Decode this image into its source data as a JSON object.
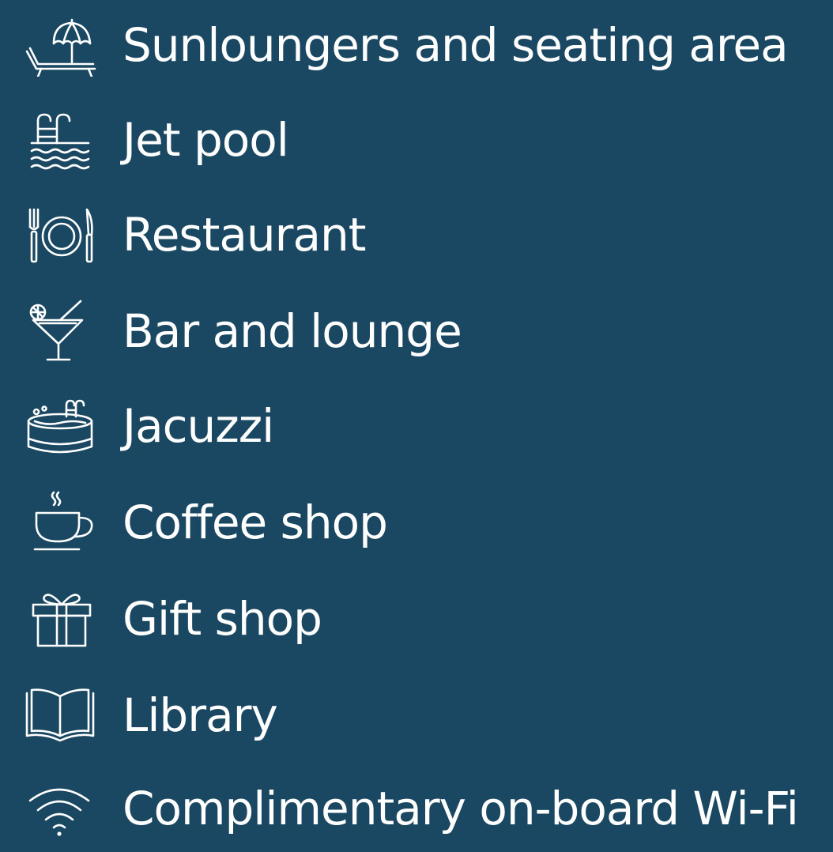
{
  "amenities": [
    {
      "icon": "sunlounger-umbrella-icon",
      "label": "Sunloungers and seating area"
    },
    {
      "icon": "pool-ladder-icon",
      "label": "Jet pool"
    },
    {
      "icon": "plate-cutlery-icon",
      "label": "Restaurant"
    },
    {
      "icon": "cocktail-glass-icon",
      "label": "Bar and lounge"
    },
    {
      "icon": "hot-tub-icon",
      "label": "Jacuzzi"
    },
    {
      "icon": "coffee-cup-icon",
      "label": "Coffee shop"
    },
    {
      "icon": "gift-box-icon",
      "label": "Gift shop"
    },
    {
      "icon": "open-book-icon",
      "label": "Library"
    },
    {
      "icon": "wifi-icon",
      "label": "Complimentary on-board Wi-Fi"
    }
  ],
  "colors": {
    "background": "#1a4761",
    "foreground": "#ffffff"
  }
}
